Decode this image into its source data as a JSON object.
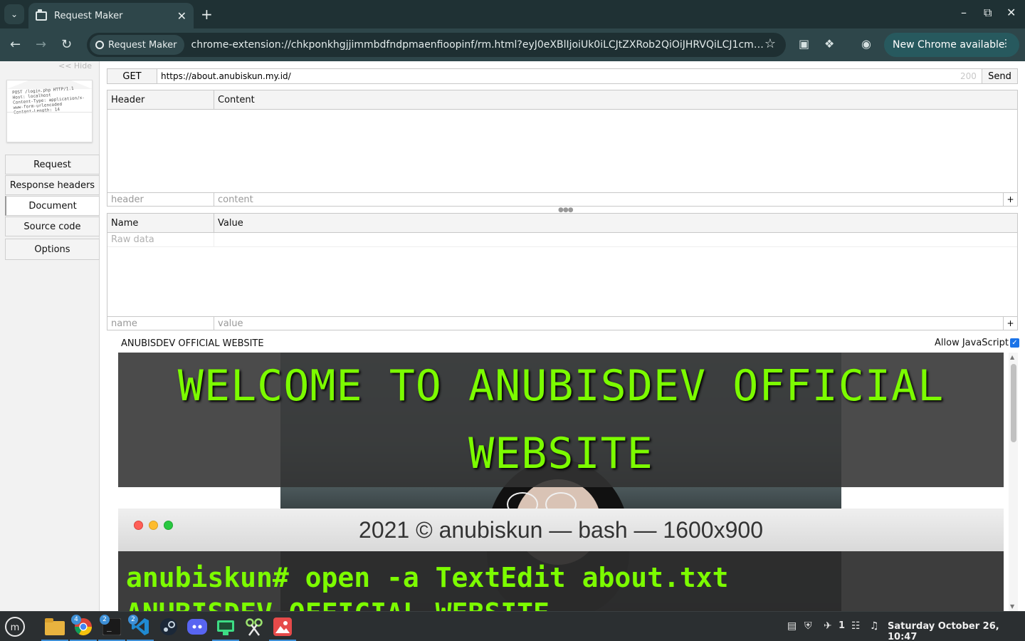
{
  "browser": {
    "tab_title": "Request Maker",
    "chip_label": "Request Maker",
    "url": "chrome-extension://chkponkhgjjimmbdfndpmaenfioopinf/rm.html?eyJ0eXBlIjoiUk0iLCJtZXRob2QiOiJHRVQiLCJ1cmwiOiJod...",
    "update_label": "New Chrome available"
  },
  "sidebar": {
    "hide_label": "<< Hide",
    "envelope_lines": [
      "POST /login.php HTTP/1.1",
      "Host: localhost",
      "Content-Type: application/x-",
      "www-form-urlencoded",
      "Content-Length: 14"
    ],
    "items": [
      {
        "label": "Request"
      },
      {
        "label": "Response headers"
      },
      {
        "label": "Document"
      },
      {
        "label": "Source code"
      },
      {
        "label": "Options"
      }
    ]
  },
  "request": {
    "method": "GET",
    "url": "https://about.anubiskun.my.id/",
    "status": "200",
    "send_label": "Send"
  },
  "headers_table": {
    "col1": "Header",
    "col2": "Content",
    "header_placeholder": "header",
    "content_placeholder": "content",
    "add_label": "+"
  },
  "params_table": {
    "col1": "Name",
    "col2": "Value",
    "raw_data_label": "Raw data",
    "name_placeholder": "name",
    "value_placeholder": "value",
    "add_label": "+"
  },
  "document": {
    "title": "ANUBISDEV OFFICIAL WEBSITE",
    "allow_js_label": "Allow JavaScript",
    "banner": "WELCOME TO ANUBISDEV OFFICIAL WEBSITE",
    "terminal_title": "2021 © anubiskun — bash — 1600x900",
    "terminal_line1": "anubiskun# open -a TextEdit about.txt",
    "terminal_line2": "ANUBISDEV OFFICIAL WEBSITE"
  },
  "taskbar": {
    "apps": [
      {
        "icon": "files-icon",
        "badge": ""
      },
      {
        "icon": "chrome-icon",
        "badge": "4"
      },
      {
        "icon": "terminal-icon",
        "badge": "2"
      },
      {
        "icon": "vscode-icon",
        "badge": "2"
      },
      {
        "icon": "steam-icon",
        "badge": ""
      },
      {
        "icon": "discord-icon",
        "badge": ""
      },
      {
        "icon": "android-studio-icon",
        "badge": ""
      },
      {
        "icon": "scissors-icon",
        "badge": ""
      },
      {
        "icon": "photos-icon",
        "badge": ""
      }
    ],
    "notification_count": "1",
    "clock": "Saturday October 26, 10:47"
  },
  "colors": {
    "accent_green": "#7cfc00",
    "chrome_frame": "#1f3134",
    "update_button": "#27595e"
  }
}
